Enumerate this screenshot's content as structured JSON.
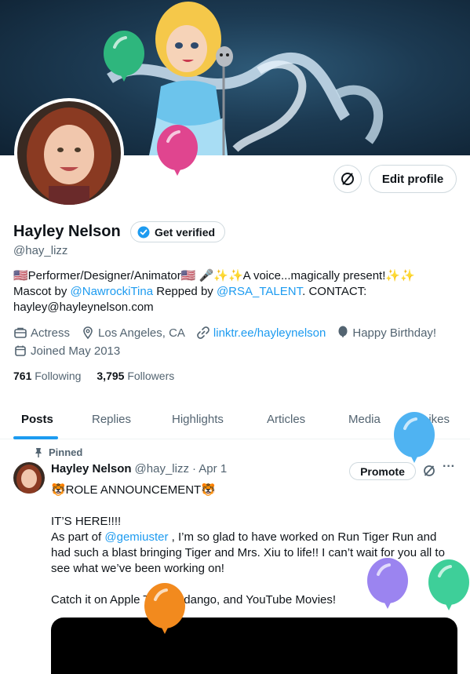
{
  "profile": {
    "name": "Hayley Nelson",
    "handle": "@hay_lizz",
    "verify_label": "Get verified",
    "edit_label": "Edit profile",
    "bio": {
      "line1": "🇺🇸Performer/Designer/Animator🇺🇸 🎤✨✨A voice...magically present!✨✨",
      "mascot_prefix": "Mascot by ",
      "mascot_link": "@NawrockiTina",
      "repped_prefix": " Repped by ",
      "repped_link": "@RSA_TALENT",
      "contact": ". CONTACT:",
      "email": "hayley@hayleynelson.com"
    },
    "meta": {
      "profession": "Actress",
      "location": "Los Angeles, CA",
      "website": "linktr.ee/hayleynelson",
      "birthday": "Happy Birthday!",
      "joined": "Joined May 2013"
    },
    "following_count": "761",
    "following_label": "Following",
    "followers_count": "3,795",
    "followers_label": "Followers"
  },
  "tabs": [
    "Posts",
    "Replies",
    "Highlights",
    "Articles",
    "Media",
    "Likes"
  ],
  "post": {
    "pinned_label": "Pinned",
    "author": "Hayley Nelson",
    "handle": "@hay_lizz",
    "time": "· Apr 1",
    "promote_label": "Promote",
    "more_label": "···",
    "line1": "🐯ROLE ANNOUNCEMENT🐯",
    "line2": "IT’S HERE!!!!",
    "line3_prefix": "As part of ",
    "line3_link": "@gemiuster",
    "line3_suffix": " , I’m so glad to have worked on Run Tiger Run and",
    "line4": "had such a blast bringing Tiger and Mrs. Xiu to life!! I can’t wait for you all to",
    "line5": "see what we’ve been working on!",
    "line6": "Catch it on Apple TV, Fandango, and YouTube Movies!"
  },
  "colors": {
    "accent": "#1d9bf0",
    "verified_badge": "#1d9bf0",
    "balloon_green": "#2eb67d",
    "balloon_pink": "#e0458f",
    "balloon_blue": "#4fb3f2",
    "balloon_purple": "#9b84f0",
    "balloon_teal": "#3ecf99",
    "balloon_orange": "#f28a1e"
  },
  "icons": {
    "analytics": "circle-slash-icon",
    "briefcase": "briefcase-icon",
    "location": "location-pin-icon",
    "link": "link-icon",
    "balloon": "balloon-icon",
    "calendar": "calendar-icon",
    "pin": "pin-icon"
  }
}
